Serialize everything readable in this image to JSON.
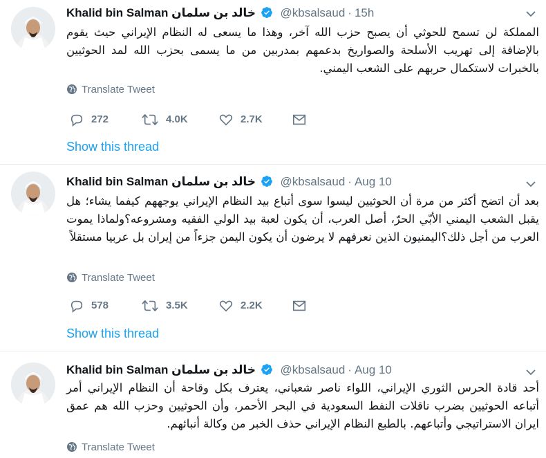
{
  "tweets": [
    {
      "name": "Khalid bin Salman خالد بن سلمان",
      "handle": "@kbsalsaud",
      "time": "15h",
      "text": "المملكة لن تسمح للحوثي أن يصبح حزب الله آخر، وهذا ما يسعى له النظام الإيراني حيث يقوم بالإضافة إلى تهريب الأسلحة والصواريخ بدعمهم بمدربين من ما يسمى بحزب الله لمد الحوثيين بالخبرات لاستكمال حربهم على الشعب اليمني.",
      "translate": "Translate Tweet",
      "replies": "272",
      "retweets": "4.0K",
      "likes": "2.7K",
      "show_thread": "Show this thread"
    },
    {
      "name": "Khalid bin Salman خالد بن سلمان",
      "handle": "@kbsalsaud",
      "time": "Aug 10",
      "text": "بعد أن اتضح أكثر من مرة أن الحوثيين ليسوا سوى أتباع بيد النظام الإيراني يوجههم كيفما يشاء؛ هل يقبل الشعب اليمني الأبّي الحرّ، أصل العرب، أن يكون لعبة بيد الولي الفقيه ومشروعه؟ولماذا يموت العرب من أجل ذلك؟اليمنيون الذين نعرفهم لا يرضون أن يكون اليمن جزءاً من إيران بل عربيا مستقلاً",
      "translate": "Translate Tweet",
      "replies": "578",
      "retweets": "3.5K",
      "likes": "2.2K",
      "show_thread": "Show this thread"
    },
    {
      "name": "Khalid bin Salman خالد بن سلمان",
      "handle": "@kbsalsaud",
      "time": "Aug 10",
      "text": "أحد قادة الحرس الثوري الإيراني، اللواء ناصر شعباني، يعترف بكل وقاحة أن النظام الإيراني أمر أتباعه الحوثيين بضرب ناقلات النفط السعودية في البحر الأحمر، وأن الحوثيين وحزب الله هم عمق ايران الاستراتيجي وأتباعهم. بالطبع النظام الإيراني حذف الخبر من وكالة أنبائهم.",
      "translate": "Translate Tweet"
    }
  ],
  "colors": {
    "link": "#1da1f2",
    "secondary": "#657786",
    "verified": "#1da1f2",
    "divider": "#e6ecf0"
  },
  "icons": [
    "verified-badge-icon",
    "caret-down-icon",
    "globe-icon",
    "reply-icon",
    "retweet-icon",
    "like-icon",
    "share-icon"
  ]
}
